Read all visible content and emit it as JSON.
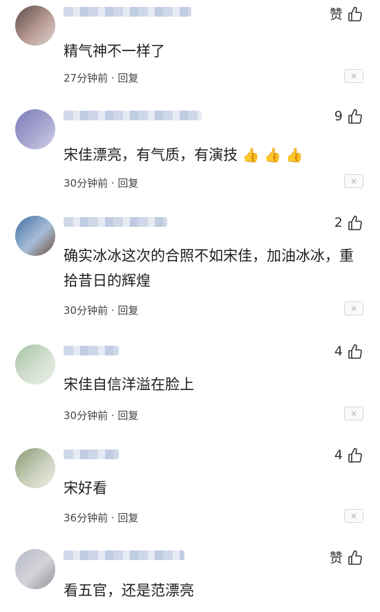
{
  "comments": [
    {
      "text": "精气神不一样了",
      "meta": "27分钟前 · 回复",
      "likes": "赞",
      "dismiss": "×",
      "avatar_colors": [
        "#5b4a49",
        "#b99b93",
        "#d9d2cf"
      ],
      "emojis": []
    },
    {
      "text": "宋佳漂亮，有气质，有演技",
      "meta": "30分钟前 · 回复",
      "likes": "9",
      "dismiss": "×",
      "avatar_colors": [
        "#7c7dbb",
        "#a6a4cf",
        "#cfd0e8"
      ],
      "emojis": [
        "👍",
        "👍",
        "👍"
      ]
    },
    {
      "text": "确实冰冰这次的合照不如宋佳，加油冰冰，重拾昔日的辉煌",
      "meta": "30分钟前 · 回复",
      "likes": "2",
      "dismiss": "×",
      "avatar_colors": [
        "#3f6fa5",
        "#a8bed6",
        "#6a4e43"
      ],
      "emojis": []
    },
    {
      "text": "宋佳自信洋溢在脸上",
      "meta": "30分钟前 · 回复",
      "likes": "4",
      "dismiss": "×",
      "avatar_colors": [
        "#a7c2a5",
        "#d3e0d0",
        "#e8efe6"
      ],
      "emojis": []
    },
    {
      "text": "宋好看",
      "meta": "36分钟前 · 回复",
      "likes": "4",
      "dismiss": "×",
      "avatar_colors": [
        "#8b9a74",
        "#c9cfbc",
        "#f0ede6"
      ],
      "emojis": []
    },
    {
      "text": "看五官，还是范漂亮",
      "meta": "",
      "likes": "赞",
      "dismiss": "",
      "avatar_colors": [
        "#b7bccb",
        "#d4d2d8",
        "#8f8c96"
      ],
      "emojis": []
    }
  ],
  "colors": {
    "text": "#1e1e1e",
    "meta": "#444444",
    "username_blur": "#c9d3e6",
    "emoji": "#f2a64a"
  },
  "icons": {
    "like": "thumbs-up-icon",
    "dismiss": "close-icon"
  }
}
